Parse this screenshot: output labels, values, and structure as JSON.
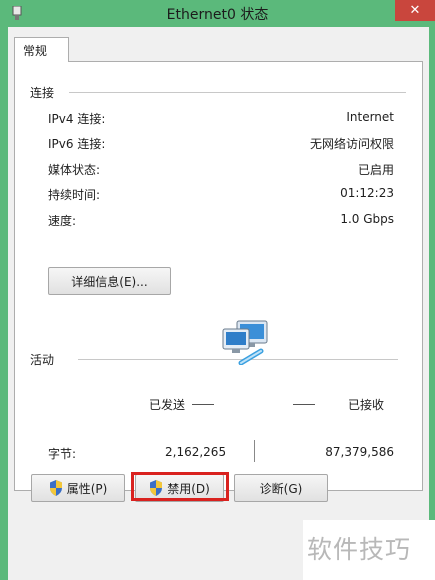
{
  "window": {
    "title": "Ethernet0 状态",
    "close_glyph": "✕"
  },
  "tabs": [
    {
      "label": "常规"
    }
  ],
  "connection": {
    "section_label": "连接",
    "rows": [
      {
        "label": "IPv4 连接:",
        "value": "Internet"
      },
      {
        "label": "IPv6 连接:",
        "value": "无网络访问权限"
      },
      {
        "label": "媒体状态:",
        "value": "已启用"
      },
      {
        "label": "持续时间:",
        "value": "01:12:23"
      },
      {
        "label": "速度:",
        "value": "1.0 Gbps"
      }
    ],
    "details_button": "详细信息(E)..."
  },
  "activity": {
    "section_label": "活动",
    "sent_label": "已发送",
    "received_label": "已接收",
    "bytes_label": "字节:",
    "bytes_sent": "2,162,265",
    "bytes_received": "87,379,586"
  },
  "buttons": {
    "properties": "属性(P)",
    "disable": "禁用(D)",
    "diagnose": "诊断(G)"
  },
  "watermark": "软件技巧",
  "colors": {
    "titlebar": "#5bb97b",
    "close": "#c9463d",
    "highlight": "#d9221f"
  }
}
